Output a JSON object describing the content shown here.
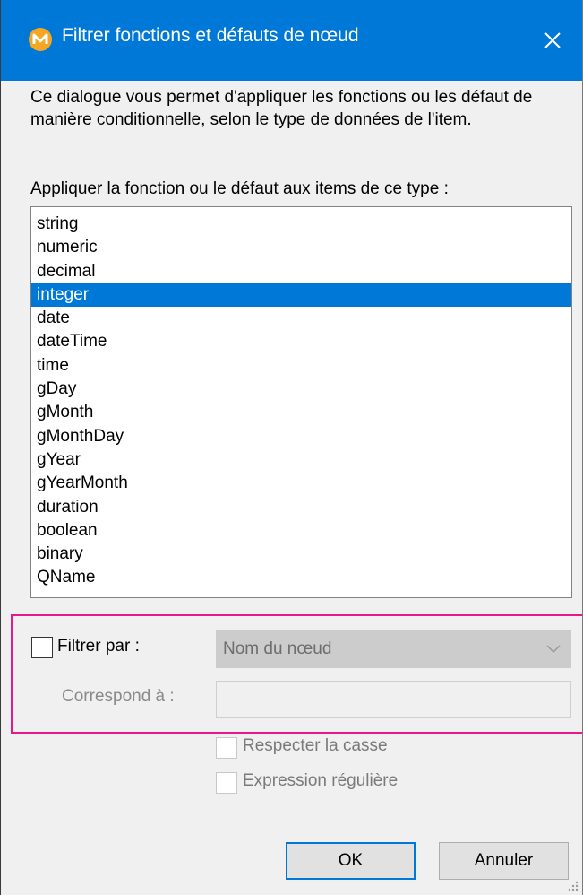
{
  "window": {
    "title": "Filtrer fonctions et défauts de nœud",
    "icon": "mapforce-app-icon",
    "close_icon": "close-icon",
    "accent_color": "#0078d7"
  },
  "description": "Ce dialogue vous permet d'appliquer les fonctions ou les défaut de manière conditionnelle, selon le type de données de l'item.",
  "list": {
    "label": "Appliquer la fonction ou le défaut aux items de ce type :",
    "items": [
      "string",
      "numeric",
      "decimal",
      "integer",
      "date",
      "dateTime",
      "time",
      "gDay",
      "gMonth",
      "gMonthDay",
      "gYear",
      "gYearMonth",
      "duration",
      "boolean",
      "binary",
      "QName"
    ],
    "selected": "integer"
  },
  "filter": {
    "checkbox_label": "Filtrer par :",
    "checked": false,
    "select_value": "Nom du nœud",
    "match_label": "Correspond à :",
    "match_value": "",
    "highlight_color": "#e5198a"
  },
  "options": {
    "case_label": "Respecter la casse",
    "regex_label": "Expression régulière"
  },
  "buttons": {
    "ok": "OK",
    "cancel": "Annuler"
  }
}
